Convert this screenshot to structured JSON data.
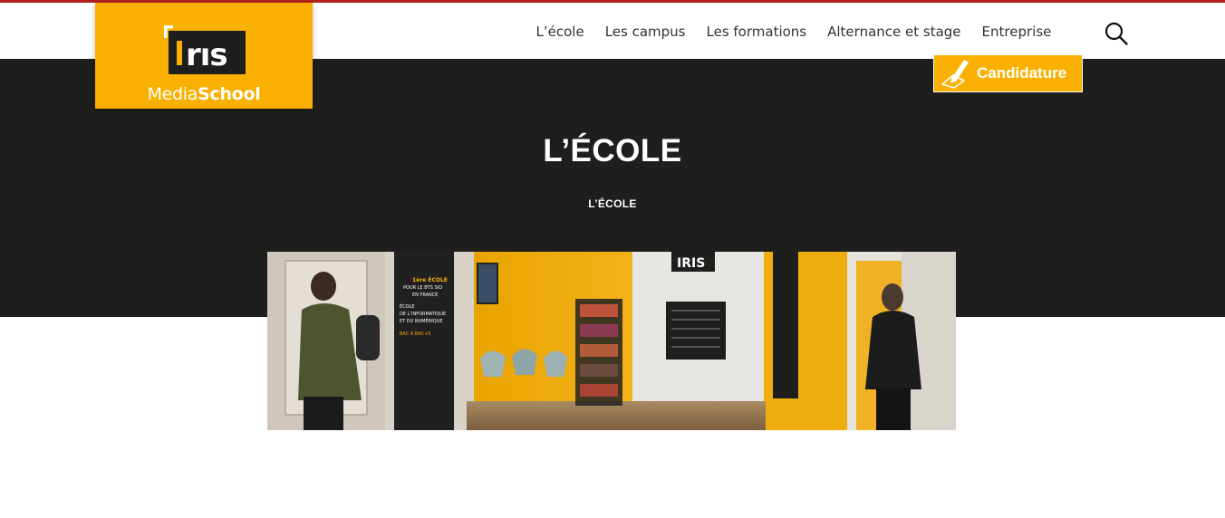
{
  "logo": {
    "mark_text": "IRIS",
    "word_regular": "Media",
    "word_bold": "School"
  },
  "nav": {
    "items": [
      {
        "label": "L’école"
      },
      {
        "label": "Les campus"
      },
      {
        "label": "Les formations"
      },
      {
        "label": "Alternance et stage"
      },
      {
        "label": "Entreprise"
      }
    ]
  },
  "search": {
    "icon": "search-icon"
  },
  "cta": {
    "label": "Candidature",
    "icon": "pen-signature-icon"
  },
  "page": {
    "title": "L’ÉCOLE",
    "breadcrumb": "L’ÉCOLE"
  },
  "photo": {
    "poster_lines": [
      "1ère ÉCOLE",
      "POUR LE BTS SIO",
      "EN FRANCE",
      "ÉCOLE",
      "DE L’INFORMATIQUE",
      "ET DU NUMÉRIQUE",
      "BAC À BAC+5"
    ],
    "wall_logo": "IRIS"
  },
  "colors": {
    "accent": "#f9b000",
    "hero": "#1e1e1d",
    "top_rule": "#b3211e"
  }
}
